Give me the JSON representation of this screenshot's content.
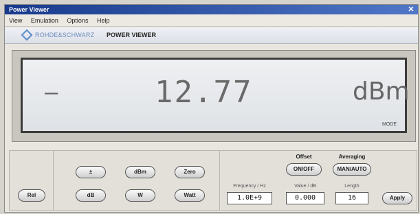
{
  "window": {
    "title": "Power Viewer",
    "close": "✕"
  },
  "menu": [
    "View",
    "Emulation",
    "Options",
    "Help"
  ],
  "brand": {
    "logo": "diamond-logo",
    "name": "ROHDE&SCHWARZ",
    "app": "POWER VIEWER"
  },
  "display": {
    "sign": "–",
    "value": "12.77",
    "unit": "dBm",
    "mode": "MODE"
  },
  "controls": {
    "left": {
      "button": "Rel"
    },
    "mid": {
      "row1": [
        "±",
        "dBm",
        "Zero"
      ],
      "row2": [
        "dB",
        "W",
        "Watt"
      ]
    },
    "right": {
      "offset": {
        "title": "Offset",
        "toggle": "ON/OFF"
      },
      "averaging": {
        "title": "Averaging",
        "toggle": "MAN/AUTO"
      },
      "fields": [
        {
          "label": "Frequency / Hz",
          "value": "1.0E+9"
        },
        {
          "label": "Value / dB",
          "value": "0.000"
        },
        {
          "label": "Length",
          "value": "16"
        }
      ],
      "apply": "Apply"
    }
  }
}
